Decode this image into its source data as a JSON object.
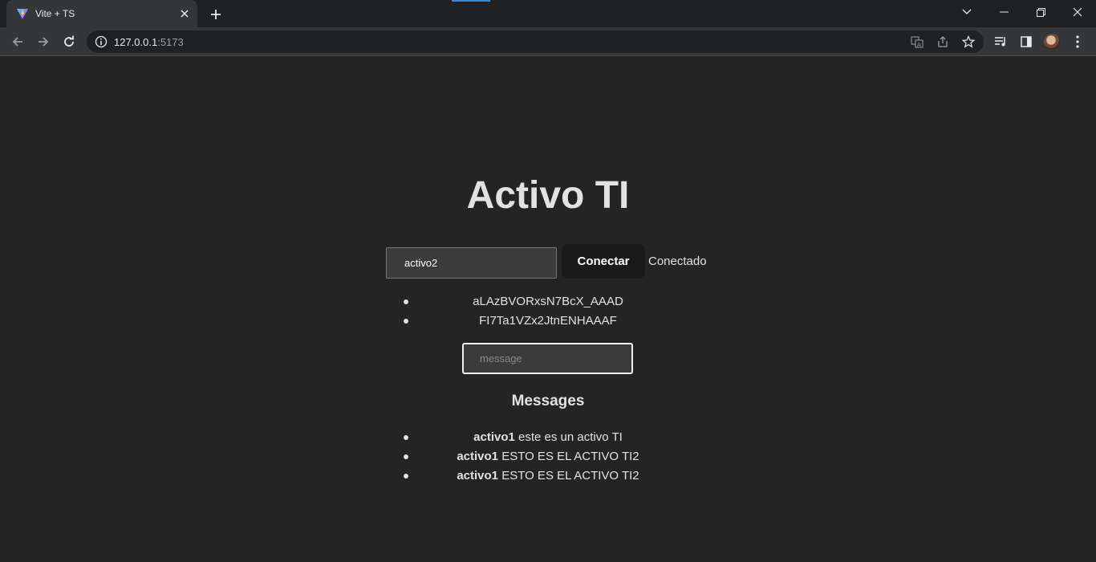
{
  "browser": {
    "tab_title": "Vite + TS",
    "url_host": "127.0.0.1",
    "url_port": ":5173"
  },
  "page": {
    "title": "Activo TI",
    "name_input_value": "activo2",
    "connect_label": "Conectar",
    "status": "Conectado",
    "clients": [
      "aLAzBVORxsN7BcX_AAAD",
      "FI7Ta1VZx2JtnENHAAAF"
    ],
    "message_placeholder": "message",
    "messages_title": "Messages",
    "messages": [
      {
        "sender": "activo1",
        "text": " este es un activo TI"
      },
      {
        "sender": "activo1",
        "text": " ESTO ES EL ACTIVO TI2"
      },
      {
        "sender": "activo1",
        "text": " ESTO ES EL ACTIVO TI2"
      }
    ]
  },
  "colors": {
    "background": "#242424",
    "browser_frame": "#202124",
    "toolbar": "#35363a",
    "button": "#1a1a1a"
  }
}
